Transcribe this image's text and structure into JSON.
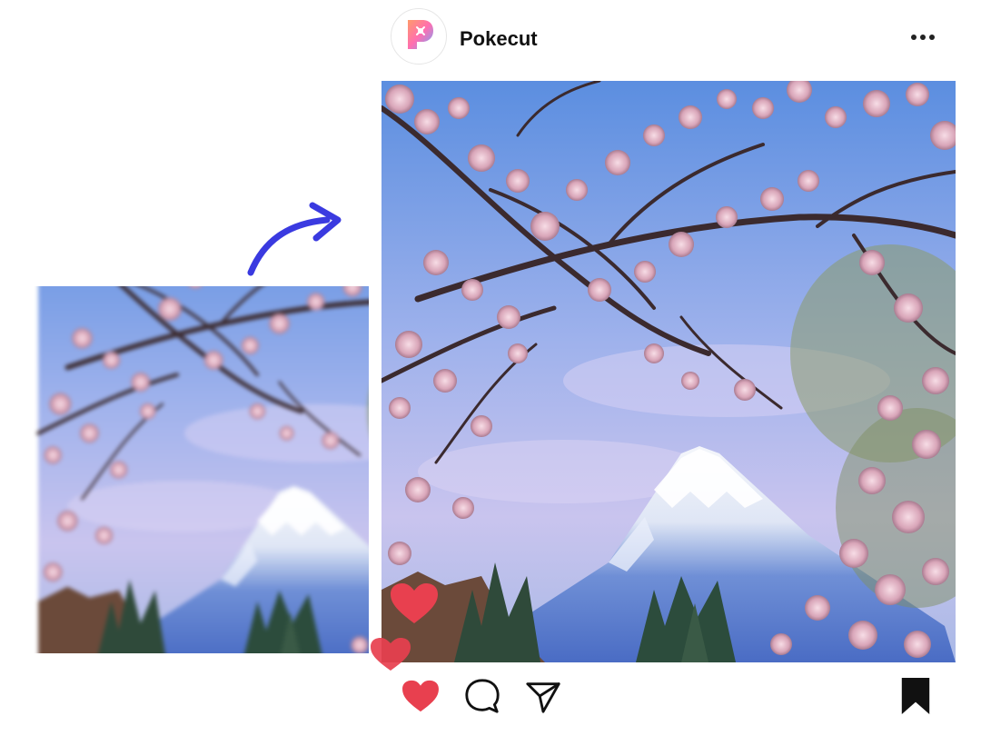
{
  "post": {
    "username": "Pokecut",
    "avatar_icon": "pokecut-logo-icon",
    "more_icon": "more-options-icon"
  },
  "actions": {
    "like_icon": "heart-icon",
    "comment_icon": "comment-icon",
    "share_icon": "paper-plane-icon",
    "save_icon": "bookmark-icon"
  },
  "colors": {
    "heart": "#e8404f",
    "arrow": "#3a3ae0",
    "sky_top": "#5b8ee0",
    "sky_bottom": "#c9c4ee",
    "blossom": "#e3b6c6"
  }
}
